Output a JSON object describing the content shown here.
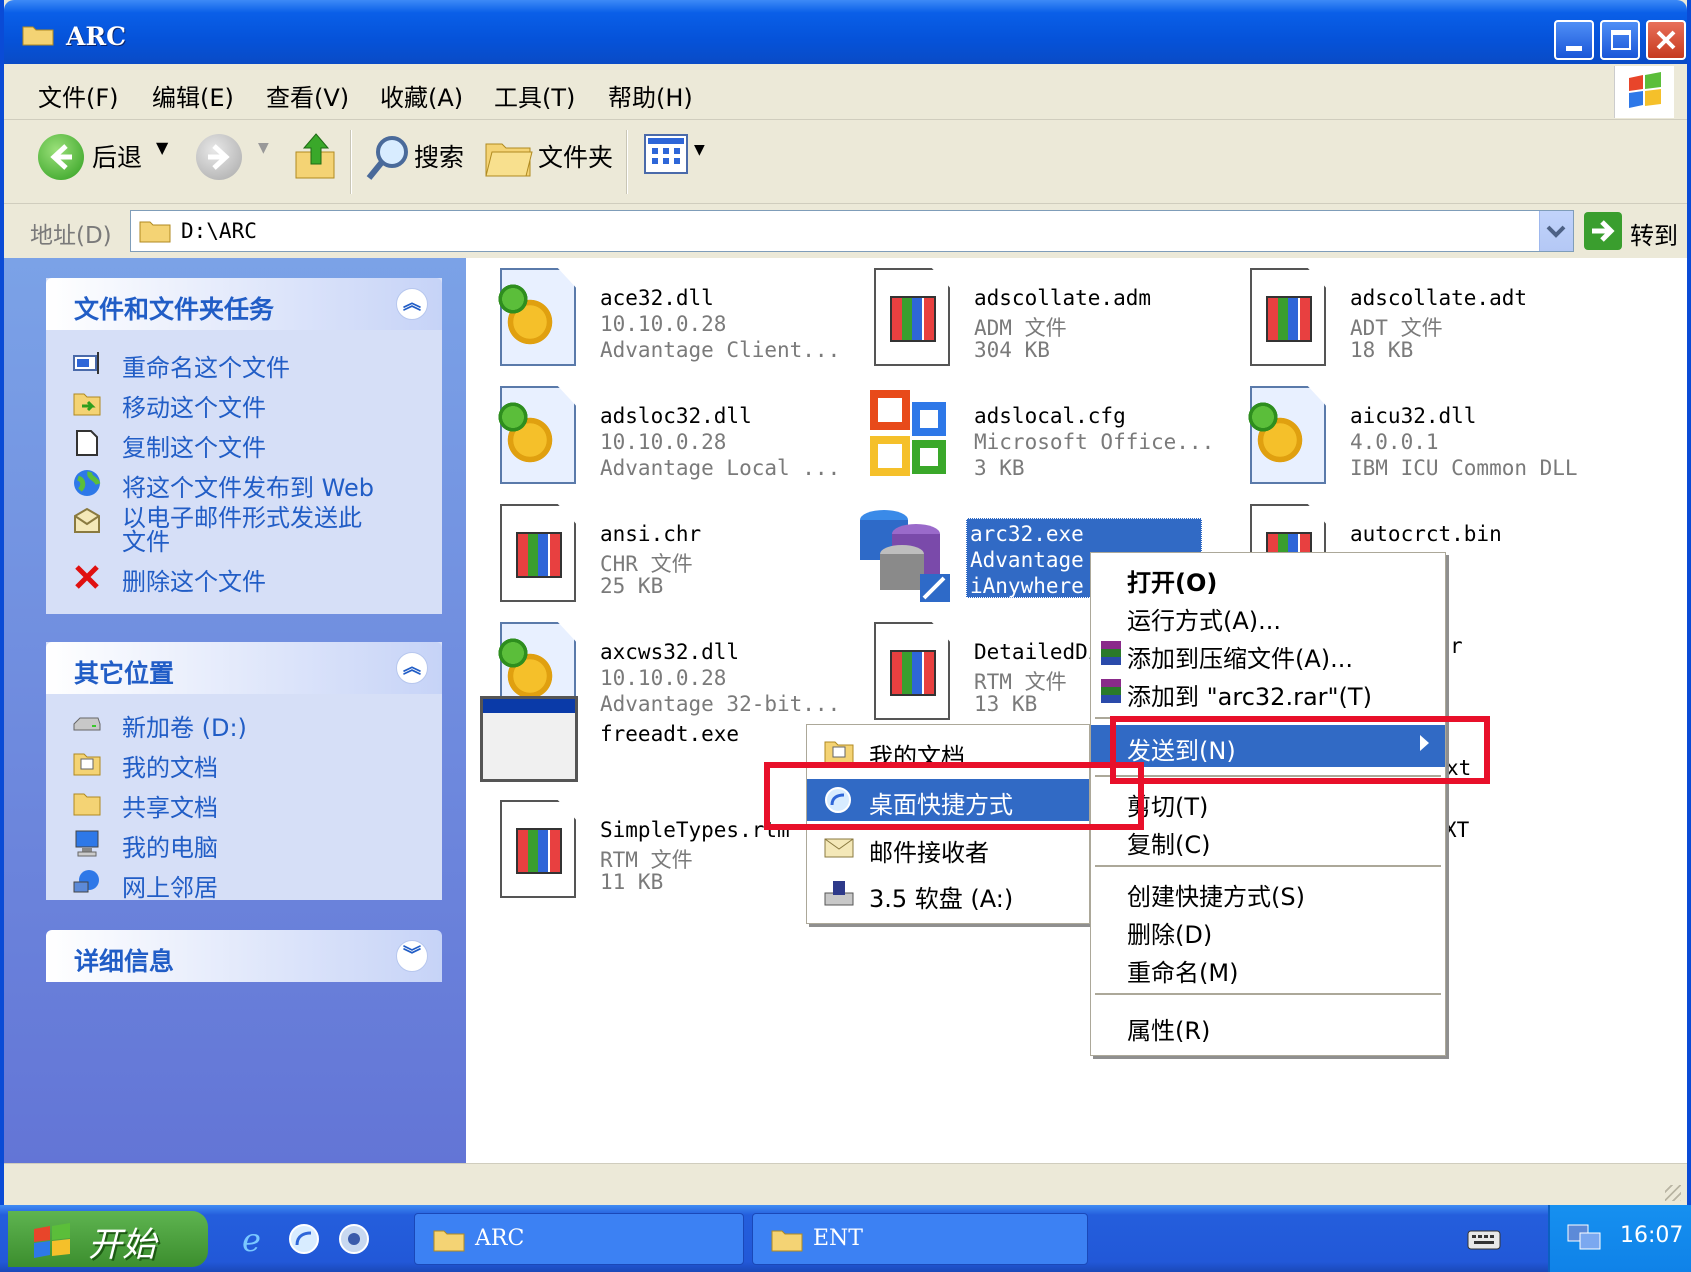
{
  "window": {
    "title": "ARC"
  },
  "menubar": {
    "items": [
      "文件(F)",
      "编辑(E)",
      "查看(V)",
      "收藏(A)",
      "工具(T)",
      "帮助(H)"
    ]
  },
  "toolbar": {
    "back_label": "后退",
    "search_label": "搜索",
    "folders_label": "文件夹"
  },
  "address": {
    "label": "地址(D)",
    "value": "D:\\ARC",
    "go_label": "转到"
  },
  "left_panel": {
    "tasks": {
      "title": "文件和文件夹任务",
      "items": [
        "重命名这个文件",
        "移动这个文件",
        "复制这个文件",
        "将这个文件发布到 Web",
        "以电子邮件形式发送此",
        "文件",
        "删除这个文件"
      ]
    },
    "other_places": {
      "title": "其它位置",
      "items": [
        "新加卷 (D:)",
        "我的文档",
        "共享文档",
        "我的电脑",
        "网上邻居"
      ]
    },
    "details": {
      "title": "详细信息"
    }
  },
  "files": [
    {
      "name": "ace32.dll",
      "line2": "10.10.0.28",
      "line3": "Advantage Client..."
    },
    {
      "name": "adscollate.adm",
      "line2": "ADM 文件",
      "line3": "304 KB"
    },
    {
      "name": "adscollate.adt",
      "line2": "ADT 文件",
      "line3": "18 KB"
    },
    {
      "name": "adsloc32.dll",
      "line2": "10.10.0.28",
      "line3": "Advantage Local ..."
    },
    {
      "name": "adslocal.cfg",
      "line2": "Microsoft Office...",
      "line3": "3 KB"
    },
    {
      "name": "aicu32.dll",
      "line2": "4.0.0.1",
      "line3": "IBM ICU Common DLL"
    },
    {
      "name": "ansi.chr",
      "line2": "CHR 文件",
      "line3": "25 KB"
    },
    {
      "name": "arc32.exe",
      "line2": "Advantage",
      "line3": "iAnywhere"
    },
    {
      "name": "autocrct.bin",
      "line2": "",
      "line3": ""
    },
    {
      "name": "axcws32.dll",
      "line2": "10.10.0.28",
      "line3": "Advantage 32-bit..."
    },
    {
      "name": "DetailedDi",
      "line2": "RTM 文件",
      "line3": "13 KB"
    },
    {
      "name": "freeadt.exe",
      "line2": "",
      "line3": ""
    },
    {
      "name": "SimpleTypes.rtm",
      "line2": "RTM 文件",
      "line3": "11 KB"
    }
  ],
  "partial_labels": {
    "row4_right": "r",
    "row5_right": "xt",
    "row6_right": "XT"
  },
  "context_menu": {
    "items": [
      "打开(O)",
      "运行方式(A)...",
      "添加到压缩文件(A)...",
      "添加到 \"arc32.rar\"(T)",
      "发送到(N)",
      "剪切(T)",
      "复制(C)",
      "创建快捷方式(S)",
      "删除(D)",
      "重命名(M)",
      "属性(R)"
    ]
  },
  "sendto_menu": {
    "items": [
      "我的文档",
      "桌面快捷方式",
      "邮件接收者",
      "3.5 软盘 (A:)"
    ]
  },
  "taskbar": {
    "start_label": "开始",
    "tasks": [
      "ARC",
      "ENT"
    ],
    "clock": "16:07"
  },
  "colors": {
    "highlight": "#316AC5",
    "annotation_red": "#E8102A",
    "link_blue": "#215DC6"
  }
}
